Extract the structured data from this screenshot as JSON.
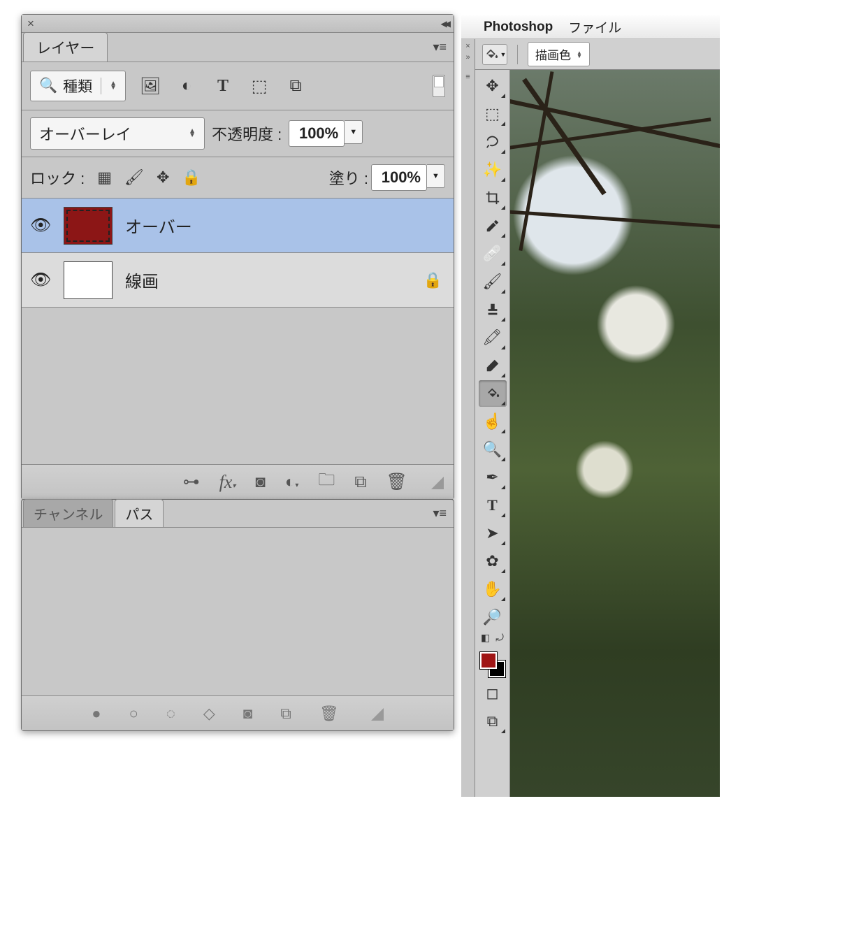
{
  "app": {
    "apple_icon": "",
    "name": "Photoshop",
    "menu_file": "ファイル"
  },
  "options_bar": {
    "tool_icon": "paint-bucket",
    "fill_mode_label": "描画色"
  },
  "layers_panel": {
    "tab_layers": "レイヤー",
    "search_menu": "種類",
    "blend_mode": "オーバーレイ",
    "opacity_label": "不透明度 :",
    "opacity_value": "100%",
    "lock_label": "ロック :",
    "fill_label": "塗り :",
    "fill_value": "100%",
    "layers": [
      {
        "name": "オーバー",
        "color": "red",
        "selected": true,
        "locked": false
      },
      {
        "name": "線画",
        "color": "white",
        "selected": false,
        "locked": true
      }
    ]
  },
  "channels_paths_panel": {
    "tab_channels": "チャンネル",
    "tab_paths": "パス"
  },
  "toolbar": {
    "tools": [
      "move",
      "marquee",
      "lasso",
      "magic-wand",
      "crop",
      "eyedropper",
      "healing",
      "brush",
      "stamp",
      "history-brush",
      "eraser",
      "paint-bucket",
      "smudge",
      "dodge",
      "pen",
      "type",
      "path-select",
      "shape",
      "hand",
      "zoom"
    ],
    "active_tool": "paint-bucket",
    "fg_color": "#a01515",
    "bg_color": "#000000"
  }
}
